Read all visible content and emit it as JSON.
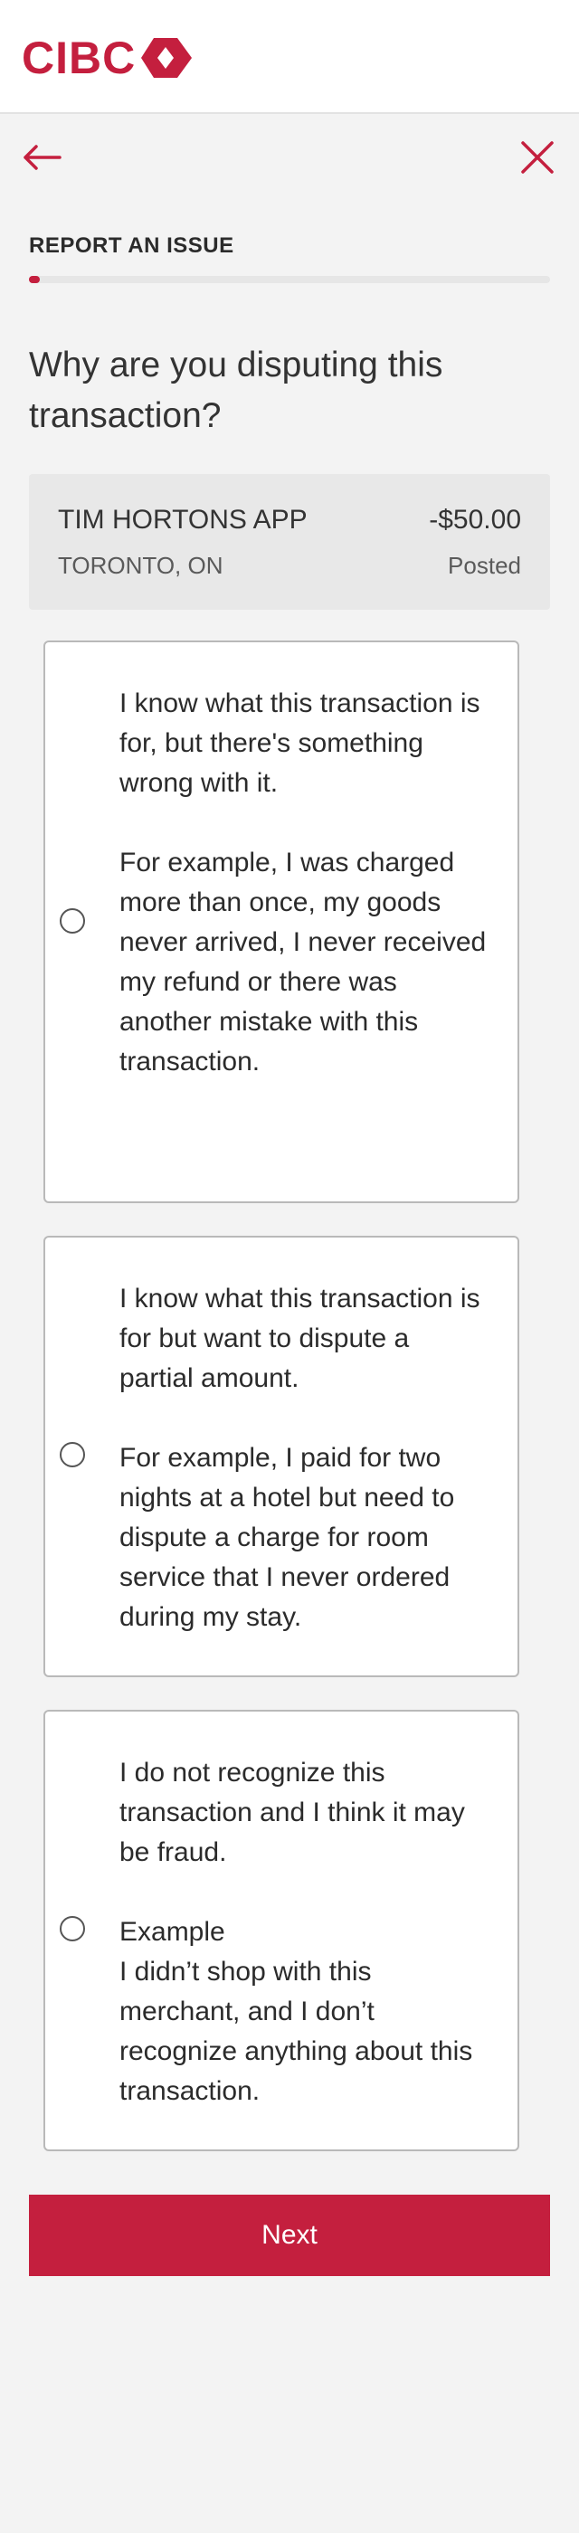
{
  "brand": {
    "logo_text": "CIBC",
    "accent_color": "#c41f3e"
  },
  "nav": {
    "back_icon": "arrow-left-icon",
    "close_icon": "close-icon"
  },
  "step": {
    "title": "REPORT AN ISSUE",
    "progress": 0.02
  },
  "question": "Why are you disputing this transaction?",
  "transaction": {
    "merchant": "TIM HORTONS APP",
    "amount": "-$50.00",
    "location": "TORONTO, ON",
    "status": "Posted"
  },
  "options": [
    {
      "heading": "I know what this transaction is for, but there's something wrong with it.",
      "detail": "For example, I was charged more than once, my goods never arrived, I never received my refund or there was another mistake with this transaction."
    },
    {
      "heading": "I know what this transaction is for but want to dispute a partial amount.",
      "detail": "For example, I paid for two nights at a hotel but need to dispute a charge for room service that I never ordered during my stay."
    },
    {
      "heading": "I do not recognize this transaction and I think it may be fraud.",
      "detail": "Example\nI didn’t shop with this merchant, and I don’t recognize anything about this transaction."
    }
  ],
  "actions": {
    "next_label": "Next"
  }
}
